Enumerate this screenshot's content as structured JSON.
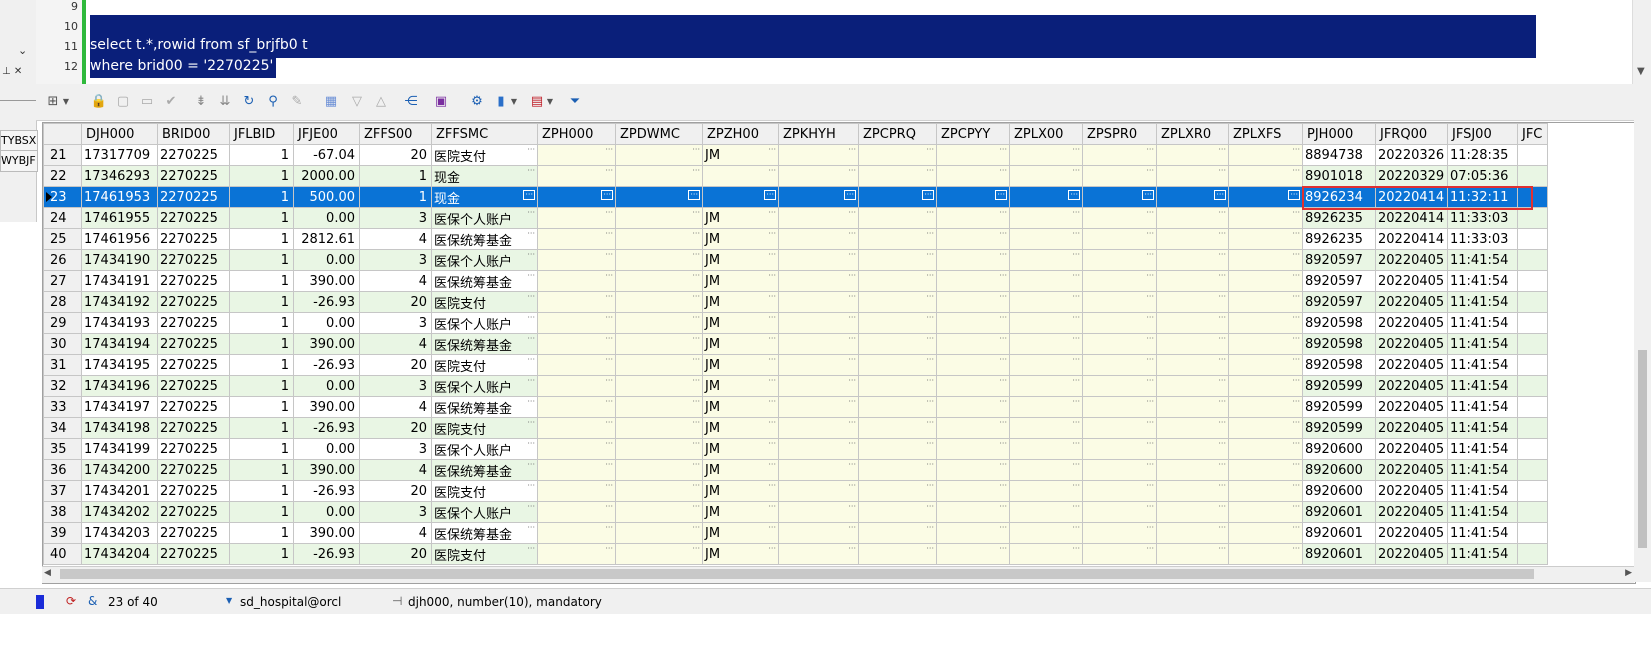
{
  "editor": {
    "line_numbers": [
      "9",
      "10",
      "11",
      "12"
    ],
    "line11": "select t.*,rowid from sf_brjfb0 t",
    "line12": "where brid00 = '2270225'"
  },
  "left_panel": {
    "pin": "⊥ ✕",
    "item1": "TYBSX",
    "item2": "WYBJF"
  },
  "grid": {
    "columns": [
      "DJH000",
      "BRID00",
      "JFLBID",
      "JFJE00",
      "ZFFS00",
      "ZFFSMC",
      "ZPH000",
      "ZPDWMC",
      "ZPZH00",
      "ZPKHYH",
      "ZPCPRQ",
      "ZPCPYY",
      "ZPLX00",
      "ZPSPR0",
      "ZPLXR0",
      "ZPLXFS",
      "PJH000",
      "JFRQ00",
      "JFSJ00",
      "JFC"
    ],
    "rows": [
      {
        "n": "21",
        "djh": "17317709",
        "brid": "2270225",
        "jflb": "1",
        "jfje": "-67.04",
        "zffs": "20",
        "zffsmc": "医院支付",
        "zpzh": "JM",
        "pjh": "8894738",
        "jfrq": "20220326",
        "jfsj": "11:28:35"
      },
      {
        "n": "22",
        "djh": "17346293",
        "brid": "2270225",
        "jflb": "1",
        "jfje": "2000.00",
        "zffs": "1",
        "zffsmc": "现金",
        "zpzh": "",
        "pjh": "8901018",
        "jfrq": "20220329",
        "jfsj": "07:05:36"
      },
      {
        "n": "23",
        "djh": "17461953",
        "brid": "2270225",
        "jflb": "1",
        "jfje": "500.00",
        "zffs": "1",
        "zffsmc": "现金",
        "zpzh": "",
        "pjh": "8926234",
        "jfrq": "20220414",
        "jfsj": "11:32:11"
      },
      {
        "n": "24",
        "djh": "17461955",
        "brid": "2270225",
        "jflb": "1",
        "jfje": "0.00",
        "zffs": "3",
        "zffsmc": "医保个人账户",
        "zpzh": "JM",
        "pjh": "8926235",
        "jfrq": "20220414",
        "jfsj": "11:33:03"
      },
      {
        "n": "25",
        "djh": "17461956",
        "brid": "2270225",
        "jflb": "1",
        "jfje": "2812.61",
        "zffs": "4",
        "zffsmc": "医保统筹基金",
        "zpzh": "JM",
        "pjh": "8926235",
        "jfrq": "20220414",
        "jfsj": "11:33:03"
      },
      {
        "n": "26",
        "djh": "17434190",
        "brid": "2270225",
        "jflb": "1",
        "jfje": "0.00",
        "zffs": "3",
        "zffsmc": "医保个人账户",
        "zpzh": "JM",
        "pjh": "8920597",
        "jfrq": "20220405",
        "jfsj": "11:41:54"
      },
      {
        "n": "27",
        "djh": "17434191",
        "brid": "2270225",
        "jflb": "1",
        "jfje": "390.00",
        "zffs": "4",
        "zffsmc": "医保统筹基金",
        "zpzh": "JM",
        "pjh": "8920597",
        "jfrq": "20220405",
        "jfsj": "11:41:54"
      },
      {
        "n": "28",
        "djh": "17434192",
        "brid": "2270225",
        "jflb": "1",
        "jfje": "-26.93",
        "zffs": "20",
        "zffsmc": "医院支付",
        "zpzh": "JM",
        "pjh": "8920597",
        "jfrq": "20220405",
        "jfsj": "11:41:54"
      },
      {
        "n": "29",
        "djh": "17434193",
        "brid": "2270225",
        "jflb": "1",
        "jfje": "0.00",
        "zffs": "3",
        "zffsmc": "医保个人账户",
        "zpzh": "JM",
        "pjh": "8920598",
        "jfrq": "20220405",
        "jfsj": "11:41:54"
      },
      {
        "n": "30",
        "djh": "17434194",
        "brid": "2270225",
        "jflb": "1",
        "jfje": "390.00",
        "zffs": "4",
        "zffsmc": "医保统筹基金",
        "zpzh": "JM",
        "pjh": "8920598",
        "jfrq": "20220405",
        "jfsj": "11:41:54"
      },
      {
        "n": "31",
        "djh": "17434195",
        "brid": "2270225",
        "jflb": "1",
        "jfje": "-26.93",
        "zffs": "20",
        "zffsmc": "医院支付",
        "zpzh": "JM",
        "pjh": "8920598",
        "jfrq": "20220405",
        "jfsj": "11:41:54"
      },
      {
        "n": "32",
        "djh": "17434196",
        "brid": "2270225",
        "jflb": "1",
        "jfje": "0.00",
        "zffs": "3",
        "zffsmc": "医保个人账户",
        "zpzh": "JM",
        "pjh": "8920599",
        "jfrq": "20220405",
        "jfsj": "11:41:54"
      },
      {
        "n": "33",
        "djh": "17434197",
        "brid": "2270225",
        "jflb": "1",
        "jfje": "390.00",
        "zffs": "4",
        "zffsmc": "医保统筹基金",
        "zpzh": "JM",
        "pjh": "8920599",
        "jfrq": "20220405",
        "jfsj": "11:41:54"
      },
      {
        "n": "34",
        "djh": "17434198",
        "brid": "2270225",
        "jflb": "1",
        "jfje": "-26.93",
        "zffs": "20",
        "zffsmc": "医院支付",
        "zpzh": "JM",
        "pjh": "8920599",
        "jfrq": "20220405",
        "jfsj": "11:41:54"
      },
      {
        "n": "35",
        "djh": "17434199",
        "brid": "2270225",
        "jflb": "1",
        "jfje": "0.00",
        "zffs": "3",
        "zffsmc": "医保个人账户",
        "zpzh": "JM",
        "pjh": "8920600",
        "jfrq": "20220405",
        "jfsj": "11:41:54"
      },
      {
        "n": "36",
        "djh": "17434200",
        "brid": "2270225",
        "jflb": "1",
        "jfje": "390.00",
        "zffs": "4",
        "zffsmc": "医保统筹基金",
        "zpzh": "JM",
        "pjh": "8920600",
        "jfrq": "20220405",
        "jfsj": "11:41:54"
      },
      {
        "n": "37",
        "djh": "17434201",
        "brid": "2270225",
        "jflb": "1",
        "jfje": "-26.93",
        "zffs": "20",
        "zffsmc": "医院支付",
        "zpzh": "JM",
        "pjh": "8920600",
        "jfrq": "20220405",
        "jfsj": "11:41:54"
      },
      {
        "n": "38",
        "djh": "17434202",
        "brid": "2270225",
        "jflb": "1",
        "jfje": "0.00",
        "zffs": "3",
        "zffsmc": "医保个人账户",
        "zpzh": "JM",
        "pjh": "8920601",
        "jfrq": "20220405",
        "jfsj": "11:41:54"
      },
      {
        "n": "39",
        "djh": "17434203",
        "brid": "2270225",
        "jflb": "1",
        "jfje": "390.00",
        "zffs": "4",
        "zffsmc": "医保统筹基金",
        "zpzh": "JM",
        "pjh": "8920601",
        "jfrq": "20220405",
        "jfsj": "11:41:54"
      },
      {
        "n": "40",
        "djh": "17434204",
        "brid": "2270225",
        "jflb": "1",
        "jfje": "-26.93",
        "zffs": "20",
        "zffsmc": "医院支付",
        "zpzh": "JM",
        "pjh": "8920601",
        "jfrq": "20220405",
        "jfsj": "11:41:54"
      }
    ],
    "selected_row": "23",
    "ellipsis": "···"
  },
  "statusbar": {
    "record_position": "23 of 40",
    "connection": "sd_hospital@orcl",
    "field_info": "djh000, number(10), mandatory"
  },
  "colors": {
    "selection": "#0a73d6",
    "editor_selection": "#0a1f7a",
    "row_green": "#e9f6e4",
    "empty_col_yellow": "#fbfce5",
    "highlight_box": "#e03030"
  }
}
